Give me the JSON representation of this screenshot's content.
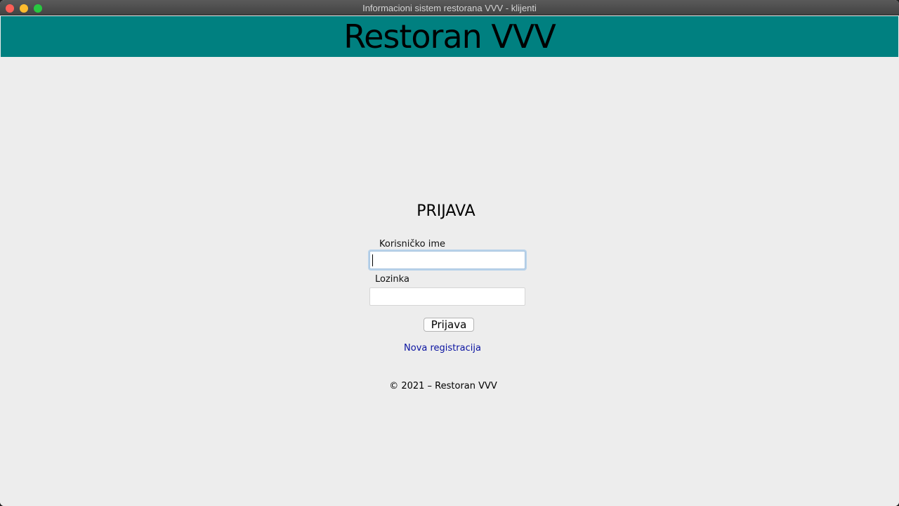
{
  "window": {
    "title": "Informacioni sistem restorana VVV - klijenti"
  },
  "header": {
    "title": "Restoran VVV",
    "background": "#008080"
  },
  "login": {
    "heading": "PRIJAVA",
    "username_label": "Korisničko ime",
    "username_value": "",
    "password_label": "Lozinka",
    "password_value": "",
    "submit_label": "Prijava",
    "register_link": "Nova registracija"
  },
  "footer": {
    "text": "© 2021 – Restoran VVV"
  },
  "colors": {
    "link": "#0a13a1",
    "background": "#ededed"
  }
}
